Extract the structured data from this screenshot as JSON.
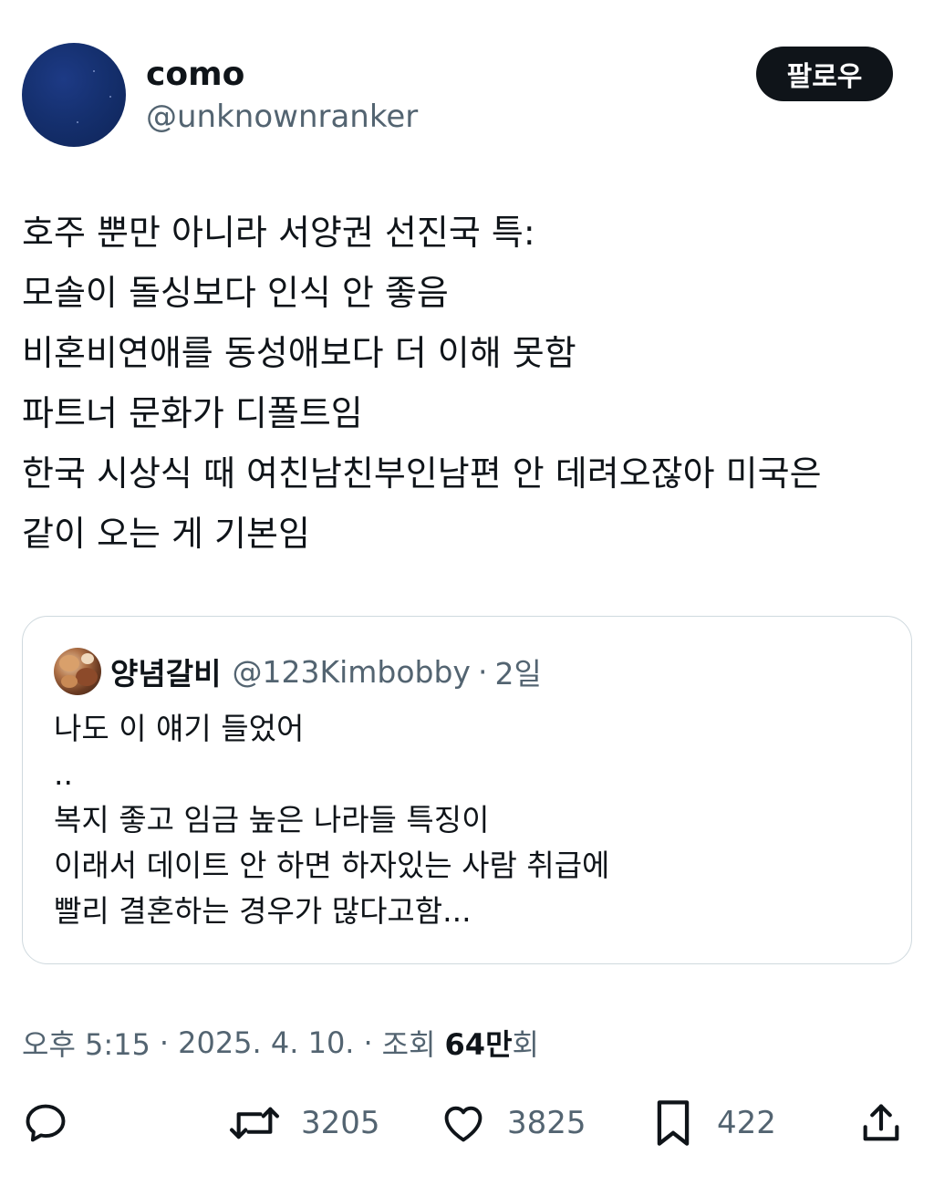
{
  "author": {
    "display_name": "como",
    "handle": "@unknownranker"
  },
  "follow_button_label": "팔로우",
  "tweet": {
    "lines": [
      "호주 뿐만 아니라 서양권 선진국 특:",
      "모솔이 돌싱보다 인식 안 좋음",
      "비혼비연애를 동성애보다 더 이해 못함",
      "파트너 문화가 디폴트임",
      "한국 시상식 때 여친남친부인남편 안 데려오잖아 미국은",
      "같이 오는 게 기본임"
    ]
  },
  "quoted_tweet": {
    "display_name": "양념갈비",
    "handle": "@123Kimbobby",
    "separator": "·",
    "time": "2일",
    "lines": [
      "나도 이 얘기 들었어",
      "..",
      "복지 좋고 임금 높은 나라들 특징이",
      "이래서 데이트 안 하면 하자있는 사람 취급에",
      "빨리 결혼하는 경우가 많다고함..."
    ]
  },
  "meta": {
    "time": "오후 5:15",
    "separator": "·",
    "date": "2025. 4. 10.",
    "views_label": "조회",
    "views_count": "64만",
    "views_suffix": "회"
  },
  "actions": {
    "reply_icon": "reply-icon",
    "retweet_icon": "retweet-icon",
    "retweet_count": "3205",
    "like_icon": "heart-icon",
    "like_count": "3825",
    "bookmark_icon": "bookmark-icon",
    "bookmark_count": "422",
    "share_icon": "share-icon"
  },
  "colors": {
    "text_primary": "#0f1419",
    "text_secondary": "#536471",
    "border": "#cfd9de",
    "follow_button_bg": "#0f1419",
    "avatar_blue": "#15306f"
  }
}
